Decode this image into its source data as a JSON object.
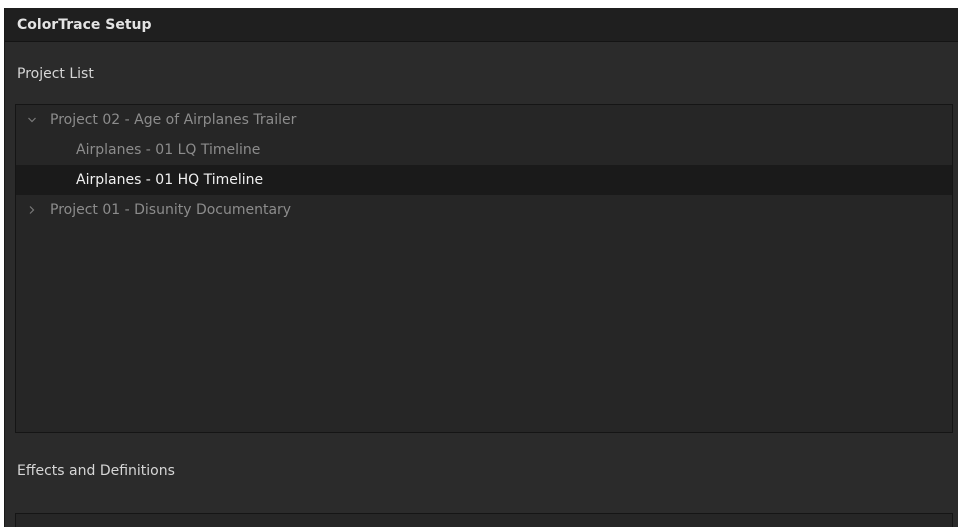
{
  "window": {
    "title": "ColorTrace Setup"
  },
  "project_list": {
    "label": "Project List",
    "items": [
      {
        "label": "Project 02 - Age of Airplanes Trailer",
        "expanded": true,
        "icon": "chevron-down-icon",
        "children": [
          {
            "label": "Airplanes - 01 LQ Timeline",
            "selected": false
          },
          {
            "label": "Airplanes - 01 HQ Timeline",
            "selected": true
          }
        ]
      },
      {
        "label": "Project 01 - Disunity Documentary",
        "expanded": false,
        "icon": "chevron-right-icon",
        "children": []
      }
    ]
  },
  "effects": {
    "label": "Effects and Definitions"
  }
}
